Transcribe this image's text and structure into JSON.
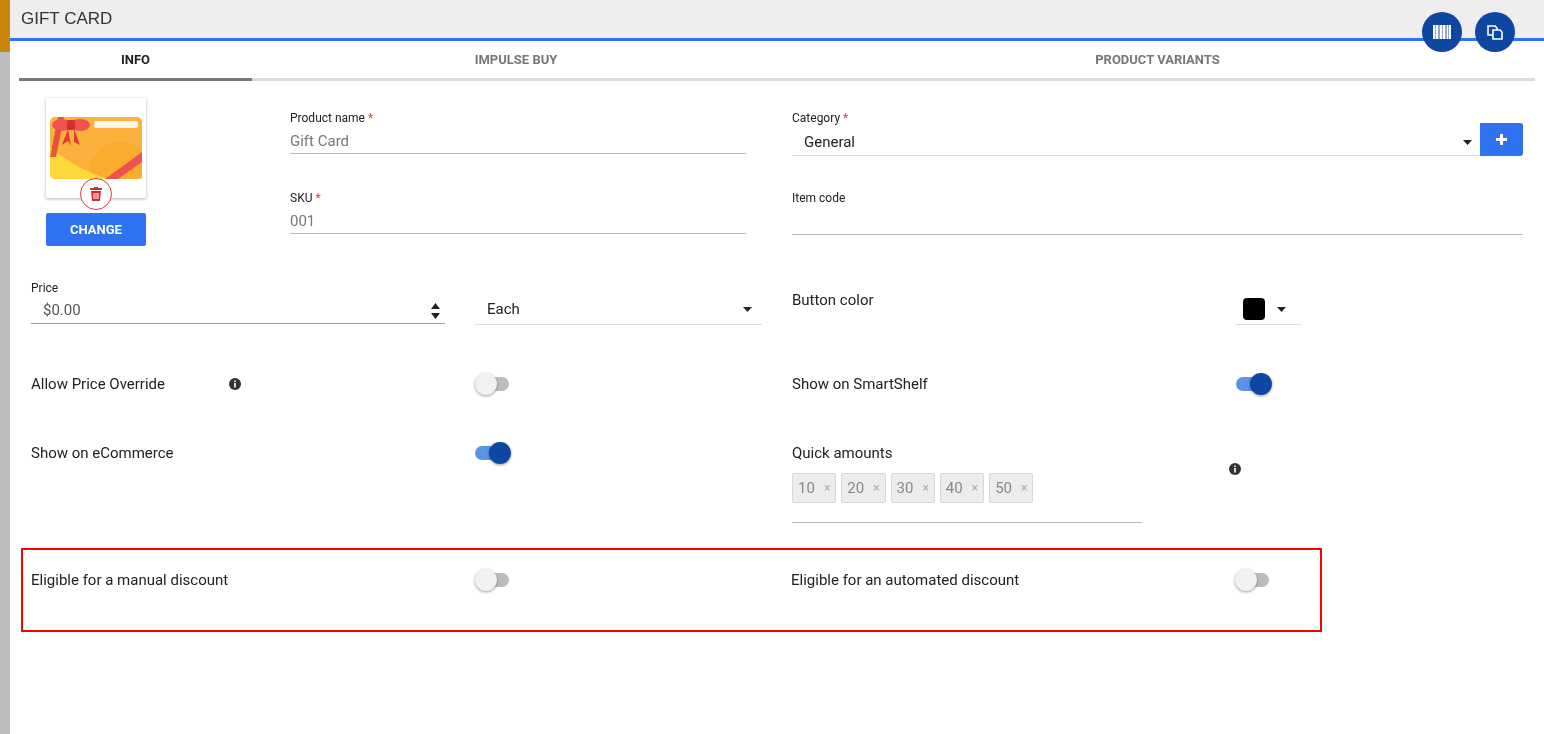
{
  "window": {
    "title": "GIFT CARD"
  },
  "tabs": [
    {
      "label": "INFO",
      "selected": true
    },
    {
      "label": "IMPULSE BUY",
      "selected": false
    },
    {
      "label": "PRODUCT VARIANTS",
      "selected": false
    }
  ],
  "image": {
    "button": "CHANGE"
  },
  "fields": {
    "product_name": {
      "label": "Product name",
      "required_mark": "*",
      "value": "Gift Card"
    },
    "category": {
      "label": "Category",
      "required_mark": "*",
      "value": "General"
    },
    "sku": {
      "label": "SKU",
      "required_mark": "*",
      "value": "001"
    },
    "item_code": {
      "label": "Item code"
    },
    "price": {
      "label": "Price",
      "value": "$0.00"
    },
    "unit": {
      "value": "Each"
    },
    "button_color": {
      "label": "Button color",
      "color": "#000000"
    }
  },
  "toggles_left": [
    {
      "label": "Allow Price Override",
      "info": true,
      "on": false
    },
    {
      "label": "Show on eCommerce",
      "info": false,
      "on": true
    }
  ],
  "smartshelf": {
    "label": "Show on SmartShelf",
    "on": true
  },
  "quick_amounts": {
    "label": "Quick amounts",
    "remove_mark": "×",
    "chips": [
      "10",
      "20",
      "30",
      "40",
      "50"
    ]
  },
  "discounts": [
    {
      "label": "Eligible for a manual discount",
      "on": false
    },
    {
      "label": "Eligible for an automated discount",
      "on": false
    }
  ]
}
